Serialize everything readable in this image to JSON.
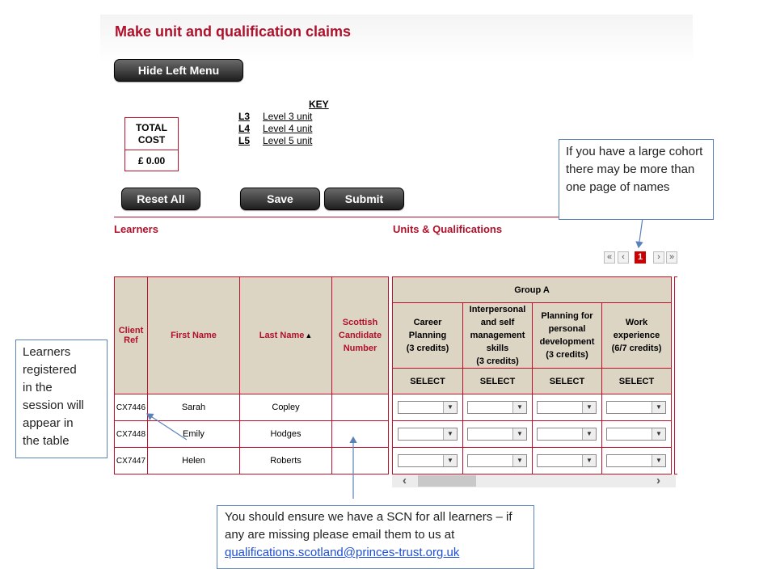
{
  "page": {
    "title": "Make unit and qualification claims"
  },
  "buttons": {
    "hide_left_menu": "Hide Left Menu",
    "reset_all": "Reset All",
    "save": "Save",
    "submit": "Submit"
  },
  "key": {
    "title": "KEY",
    "items": [
      {
        "code": "L3",
        "label": "Level 3 unit"
      },
      {
        "code": "L4",
        "label": "Level 4 unit"
      },
      {
        "code": "L5",
        "label": "Level 5 unit"
      }
    ]
  },
  "total_cost": {
    "label_line1": "TOTAL",
    "label_line2": "COST",
    "value": "£ 0.00"
  },
  "sections": {
    "learners": "Learners",
    "units": "Units & Qualifications"
  },
  "pagination": {
    "first": "«",
    "prev": "‹",
    "current": "1",
    "next": "›",
    "last": "»"
  },
  "table": {
    "headers": {
      "client_ref_1": "Client",
      "client_ref_2": "Ref",
      "first_name": "First Name",
      "last_name": "Last Name",
      "sort_indicator": "▲",
      "scn_1": "Scottish",
      "scn_2": "Candidate",
      "scn_3": "Number"
    },
    "group": "Group A",
    "units": [
      {
        "line1": "Career",
        "line2": "Planning",
        "line3": "(3 credits)",
        "line4": ""
      },
      {
        "line1": "Interpersonal",
        "line2": "and self",
        "line3": "management",
        "line4": "skills",
        "line5": "(3 credits)"
      },
      {
        "line1": "Planning for",
        "line2": "personal",
        "line3": "development",
        "line4": "(3 credits)"
      },
      {
        "line1": "Work",
        "line2": "experience",
        "line3": "(6/7 credits)",
        "line4": ""
      }
    ],
    "select_label": "SELECT",
    "rows": [
      {
        "client_ref": "CX7446",
        "first_name": "Sarah",
        "last_name": "Copley",
        "scn": ""
      },
      {
        "client_ref": "CX7448",
        "first_name": "Emily",
        "last_name": "Hodges",
        "scn": ""
      },
      {
        "client_ref": "CX7447",
        "first_name": "Helen",
        "last_name": "Roberts",
        "scn": ""
      }
    ]
  },
  "callouts": {
    "pages": "If  you have a large cohort there may be more than one page of names",
    "learners_line1": "Learners",
    "learners_line2": "registered",
    "learners_line3": "in the",
    "learners_line4": "session will",
    "learners_line5": "appear in",
    "learners_line6": "the table",
    "scn_text": "You should ensure we have a SCN for all learners – if any are missing please email them to us at",
    "scn_email": "qualifications.scotland@princes-trust.org.uk"
  },
  "colors": {
    "brand_red": "#b0102a",
    "header_beige": "#ddd5c4",
    "callout_border": "#5a82b8",
    "link_blue": "#1f4fd6"
  }
}
